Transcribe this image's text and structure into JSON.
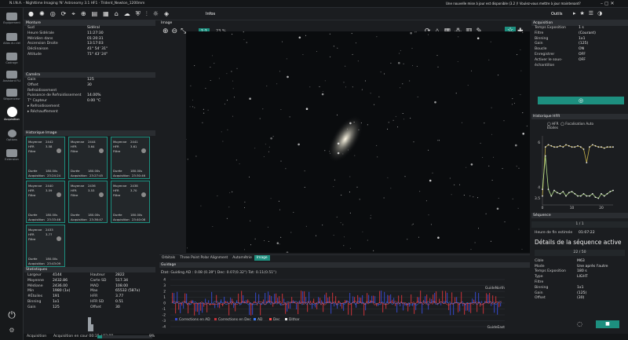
{
  "app": {
    "title": "N.I.N.A. - Nighttime Imaging 'N' Astronomy 3.1 HF1 · Trident_Newton_1200mm",
    "update_notice": "Une nouvelle mise à jour est disponible (3.2 )! Voulez-vous mettre à jour maintenant?"
  },
  "nav": [
    {
      "label": "Équipement"
    },
    {
      "label": "Atlas du ciel"
    },
    {
      "label": "Cadrage"
    },
    {
      "label": "Assistant FLI"
    },
    {
      "label": "Séquenceur"
    },
    {
      "label": "Acquisition"
    },
    {
      "label": "Options"
    },
    {
      "label": "Extension"
    }
  ],
  "toolbar": {
    "infos": "Infos",
    "outils": "Outils"
  },
  "mount": {
    "title": "Monture",
    "rows": [
      [
        "Sud",
        "Sidéral"
      ],
      [
        "Heure Sidérale",
        "11:27:30"
      ],
      [
        "Méridien dans",
        "01:20:31"
      ],
      [
        "Ascension Droite",
        "13:17:03"
      ],
      [
        "Déclinaison",
        "41° 54' 31\""
      ],
      [
        "Altitude",
        "71° 43' 24\""
      ]
    ]
  },
  "camera": {
    "title": "Caméra",
    "rows": [
      [
        "Gain",
        "125"
      ],
      [
        "Offset",
        "30"
      ],
      [
        "Refroidissement",
        ""
      ],
      [
        "Puissance de Refroidissement",
        "14.00%"
      ],
      [
        "T° Capteur",
        "0.00 °C"
      ]
    ],
    "cool": "Refroidissement",
    "warm": "Réchauffement"
  },
  "history": {
    "title": "Historique Image",
    "tiles": [
      {
        "moy": "2442",
        "hfr": "3.58",
        "time": "23:24:24"
      },
      {
        "moy": "2444",
        "hfr": "3.64",
        "time": "23:27:45"
      },
      {
        "moy": "2441",
        "hfr": "3.61",
        "time": "23:30:46"
      },
      {
        "moy": "2440",
        "hfr": "3.59",
        "time": "23:33:46"
      },
      {
        "moy": "2436",
        "hfr": "3.53",
        "time": "23:36:47"
      },
      {
        "moy": "2438",
        "hfr": "3.70",
        "time": "23:40:08"
      },
      {
        "moy": "2433",
        "hfr": "3.77",
        "time": "23:43:09"
      }
    ],
    "l_moy": "Moyenne",
    "l_hfr": "HFR",
    "l_filtre": "Filtre",
    "l_duree": "Durée",
    "duree": "180.00s",
    "l_acq": "Acquisition"
  },
  "stats": {
    "title": "Statistiques",
    "left": [
      [
        "Largeur",
        "4144"
      ],
      [
        "Moyenne",
        "2432.86"
      ],
      [
        "Médiane",
        "2436.00"
      ],
      [
        "Min",
        "1980 (1x)"
      ],
      [
        "#Étoiles",
        "191"
      ],
      [
        "Binning",
        "1x1"
      ],
      [
        "Gain",
        "125"
      ]
    ],
    "right": [
      [
        "Hauteur",
        "2822"
      ],
      [
        "Carte SD",
        "517.34"
      ],
      [
        "MAD",
        "108.00"
      ],
      [
        "Max",
        "65532 (587x)"
      ],
      [
        "HFR",
        "3.77"
      ],
      [
        "HFR SD",
        "0.51"
      ],
      [
        "Offset",
        "30"
      ]
    ]
  },
  "status": {
    "acq": "Acquisition",
    "progress": "Acquisition en cour 00:15 / 03:00",
    "pct": "9%"
  },
  "image": {
    "title": "Image",
    "zoom": "23 %",
    "fit": "1:1",
    "tabs": [
      "Orbitals",
      "Three Point Polar Alignment",
      "Autométrie",
      "Image"
    ]
  },
  "guiding": {
    "title": "Guidage",
    "rms": "État: Guiding AD : 0.08 (0.39\")  Dec: 0.07(0.32\")  Tot: 0.11(0.51\")",
    "north": "GuideNorth",
    "east": "GuideEast",
    "y_ticks": [
      "4",
      "3",
      "2",
      "1",
      "0",
      "-1",
      "-2",
      "-3",
      "-4"
    ],
    "legend": [
      "Corrections en AD",
      "Corrections en Dec",
      "AD",
      "Dec",
      "Dithar"
    ]
  },
  "acquisition": {
    "title": "Acquisition",
    "rows": [
      [
        "Temps Exposition",
        "1 s"
      ],
      [
        "Filtre",
        "(Courant)"
      ],
      [
        "Binning",
        "1x1"
      ],
      [
        "Gain",
        "(125)"
      ],
      [
        "Boucle",
        "ON"
      ],
      [
        "Enregistrer",
        "OFF"
      ],
      [
        "Activer le sous-échantillon",
        "OFF"
      ]
    ]
  },
  "hfr": {
    "title": "Historique HFR",
    "legend": [
      "HFR",
      "Focalisation Auto",
      "Étoiles"
    ],
    "y_ticks": [
      "6",
      "4",
      "3.5"
    ],
    "x_ticks": [
      "0",
      "10",
      "20"
    ]
  },
  "chart_data": {
    "type": "line",
    "series": [
      {
        "name": "HFR",
        "values": [
          3.6,
          5.8,
          5.9,
          5.85,
          5.8,
          5.8,
          5.85,
          5.8,
          5.9,
          5.85,
          5.8,
          5.8,
          5.85,
          5.8,
          5.7,
          5.1,
          5.8,
          5.9,
          5.85,
          5.8,
          5.8,
          5.75,
          5.8,
          5.8,
          5.8
        ]
      },
      {
        "name": "Étoiles",
        "values": [
          3.9,
          5.4,
          3.9,
          3.6,
          3.85,
          3.75,
          3.7,
          3.8,
          3.6,
          3.75,
          3.8,
          3.7,
          3.6,
          3.6,
          3.7,
          3.6,
          3.6,
          3.7,
          3.55,
          3.5,
          3.7,
          3.6,
          3.7,
          3.8,
          3.85
        ]
      }
    ],
    "ylim": [
      3.2,
      6.3
    ],
    "xlim": [
      0,
      24
    ]
  },
  "sequence": {
    "title": "Séquence",
    "page": "1 / 1",
    "end_label": "Heure de fin estimée",
    "end": "01:07:22",
    "detail_title": "Détails de la séquence active",
    "counter": "22 / 50",
    "rows": [
      [
        "Cible",
        "M63"
      ],
      [
        "Mode",
        "Une après l'autre"
      ],
      [
        "Temps Exposition",
        "180 s"
      ],
      [
        "Type",
        "LIGHT"
      ],
      [
        "Filtre",
        ""
      ],
      [
        "Binning",
        "1x1"
      ],
      [
        "Gain",
        "(125)"
      ],
      [
        "Offset",
        "(30)"
      ]
    ]
  }
}
